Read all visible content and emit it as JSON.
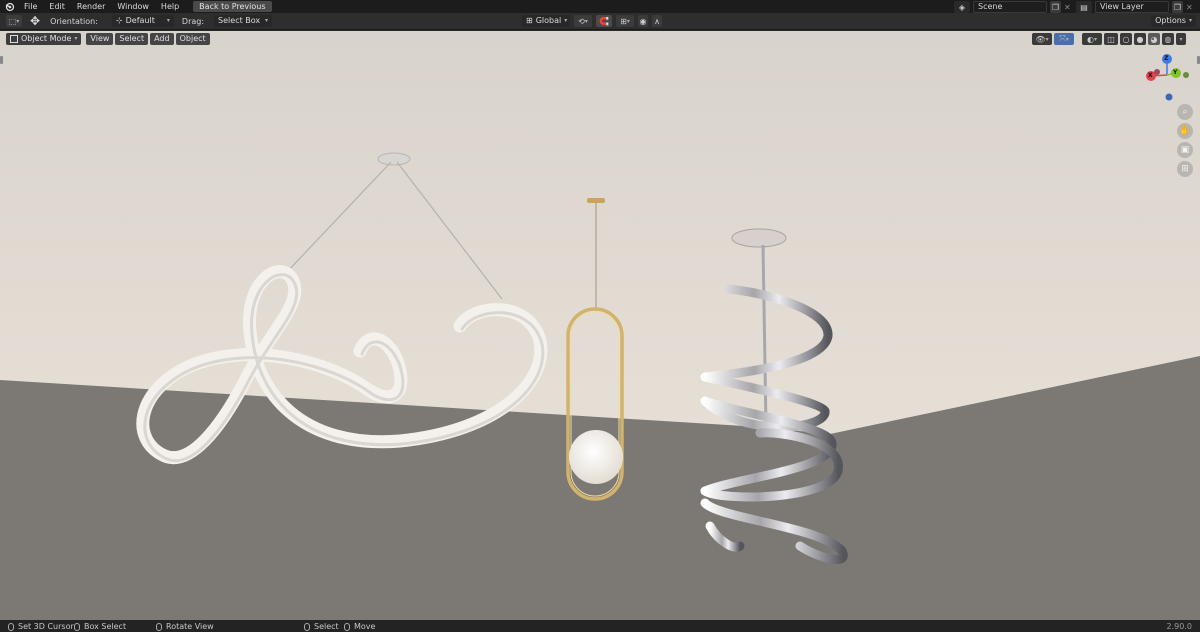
{
  "topbar": {
    "menus": [
      "File",
      "Edit",
      "Render",
      "Window",
      "Help"
    ],
    "back_button": "Back to Previous",
    "scene": {
      "label": "Scene"
    },
    "view_layer": {
      "label": "View Layer"
    }
  },
  "toolbar": {
    "orientation_label": "Orientation:",
    "orientation_value": "Default",
    "drag_label": "Drag:",
    "drag_value": "Select Box",
    "transform_space": "Global",
    "options": "Options"
  },
  "viewport_header": {
    "mode": "Object Mode",
    "menus": [
      "View",
      "Select",
      "Add",
      "Object"
    ]
  },
  "gizmo": {
    "x": "X",
    "y": "Y",
    "z": "Z"
  },
  "statusbar": {
    "items": [
      "Set 3D Cursor",
      "Box Select",
      "Rotate View",
      "Select",
      "Move"
    ],
    "version": "2.90.0"
  },
  "colors": {
    "gizmo_x": "#e5404e",
    "gizmo_y": "#7ec624",
    "gizmo_z": "#3e7ce6",
    "ceiling": "#ded8d0",
    "floor": "#7c7874"
  },
  "icons": [
    "blender-logo-icon",
    "select-box-icon",
    "move-cursor-icon",
    "pivot-icon",
    "snap-icon",
    "proportional-icon",
    "zoom-icon",
    "hand-icon",
    "camera-icon",
    "grid-icon"
  ]
}
